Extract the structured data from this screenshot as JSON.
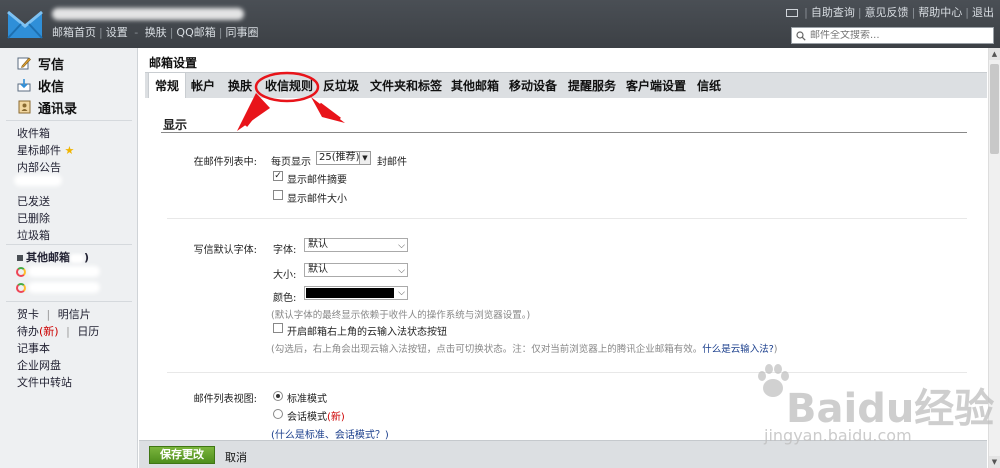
{
  "topbar": {
    "links": [
      "邮箱首页",
      "设置",
      "换肤",
      "QQ邮箱",
      "同事圈"
    ],
    "right_links": [
      "自助查询",
      "意见反馈",
      "帮助中心",
      "退出"
    ],
    "search_placeholder": "邮件全文搜索..."
  },
  "sidebar": {
    "actions": [
      "写信",
      "收信",
      "通讯录"
    ],
    "folders": [
      "收件箱",
      "星标邮件",
      "内部公告",
      "已发送",
      "已删除",
      "垃圾箱"
    ],
    "other_mail_label": "其他邮箱",
    "other_mail_suffix": ")",
    "tools": {
      "greeting_card": "贺卡",
      "postcard": "明信片",
      "todo": "待办",
      "new_badge": "(新)",
      "calendar": "日历",
      "notepad": "记事本",
      "netdisk": "企业网盘",
      "file_transfer": "文件中转站"
    },
    "separator": "|"
  },
  "content": {
    "page_title": "邮箱设置",
    "tabs": [
      "常规",
      "帐户",
      "换肤",
      "收信规则",
      "反垃圾",
      "文件夹和标签",
      "其他邮箱",
      "移动设备",
      "提醒服务",
      "客户端设置",
      "信纸"
    ],
    "active_tab": "常规",
    "section_title": "显示",
    "mail_list": {
      "label": "在邮件列表中:",
      "per_page_prefix": "每页显示",
      "per_page_value": "25(推荐)",
      "per_page_suffix": "封邮件",
      "show_summary": "显示邮件摘要",
      "show_summary_checked": true,
      "show_size": "显示邮件大小",
      "show_size_checked": false
    },
    "font": {
      "label": "写信默认字体:",
      "family_label": "字体:",
      "family_value": "默认",
      "size_label": "大小:",
      "size_value": "默认",
      "color_label": "颜色:",
      "color_value": "#000000",
      "note": "(默认字体的最终显示依赖于收件人的操作系统与浏览器设置。)",
      "cloud_ime": "开启邮箱右上角的云输入法状态按钮",
      "cloud_ime_hint": "(勾选后，右上角会出现云输入法按钮，点击可切换状态。注：仅对当前浏览器上的腾讯企业邮箱有效。",
      "cloud_ime_link": "什么是云输入法?",
      "cloud_ime_close": ")"
    },
    "view": {
      "label": "邮件列表视图:",
      "standard": "标准模式",
      "conversation": "会话模式",
      "new_badge": "(新)",
      "help": "(什么是标准、会话模式？)"
    }
  },
  "bottom": {
    "save": "保存更改",
    "cancel": "取消"
  },
  "watermark": {
    "line1": "Baidu经验",
    "line2": "jingyan.baidu.com"
  },
  "colors": {
    "topbar": "#43474c",
    "annotation_red": "#e8141a",
    "save_green": "#5a9b24",
    "link_blue": "#1a3e8c"
  }
}
